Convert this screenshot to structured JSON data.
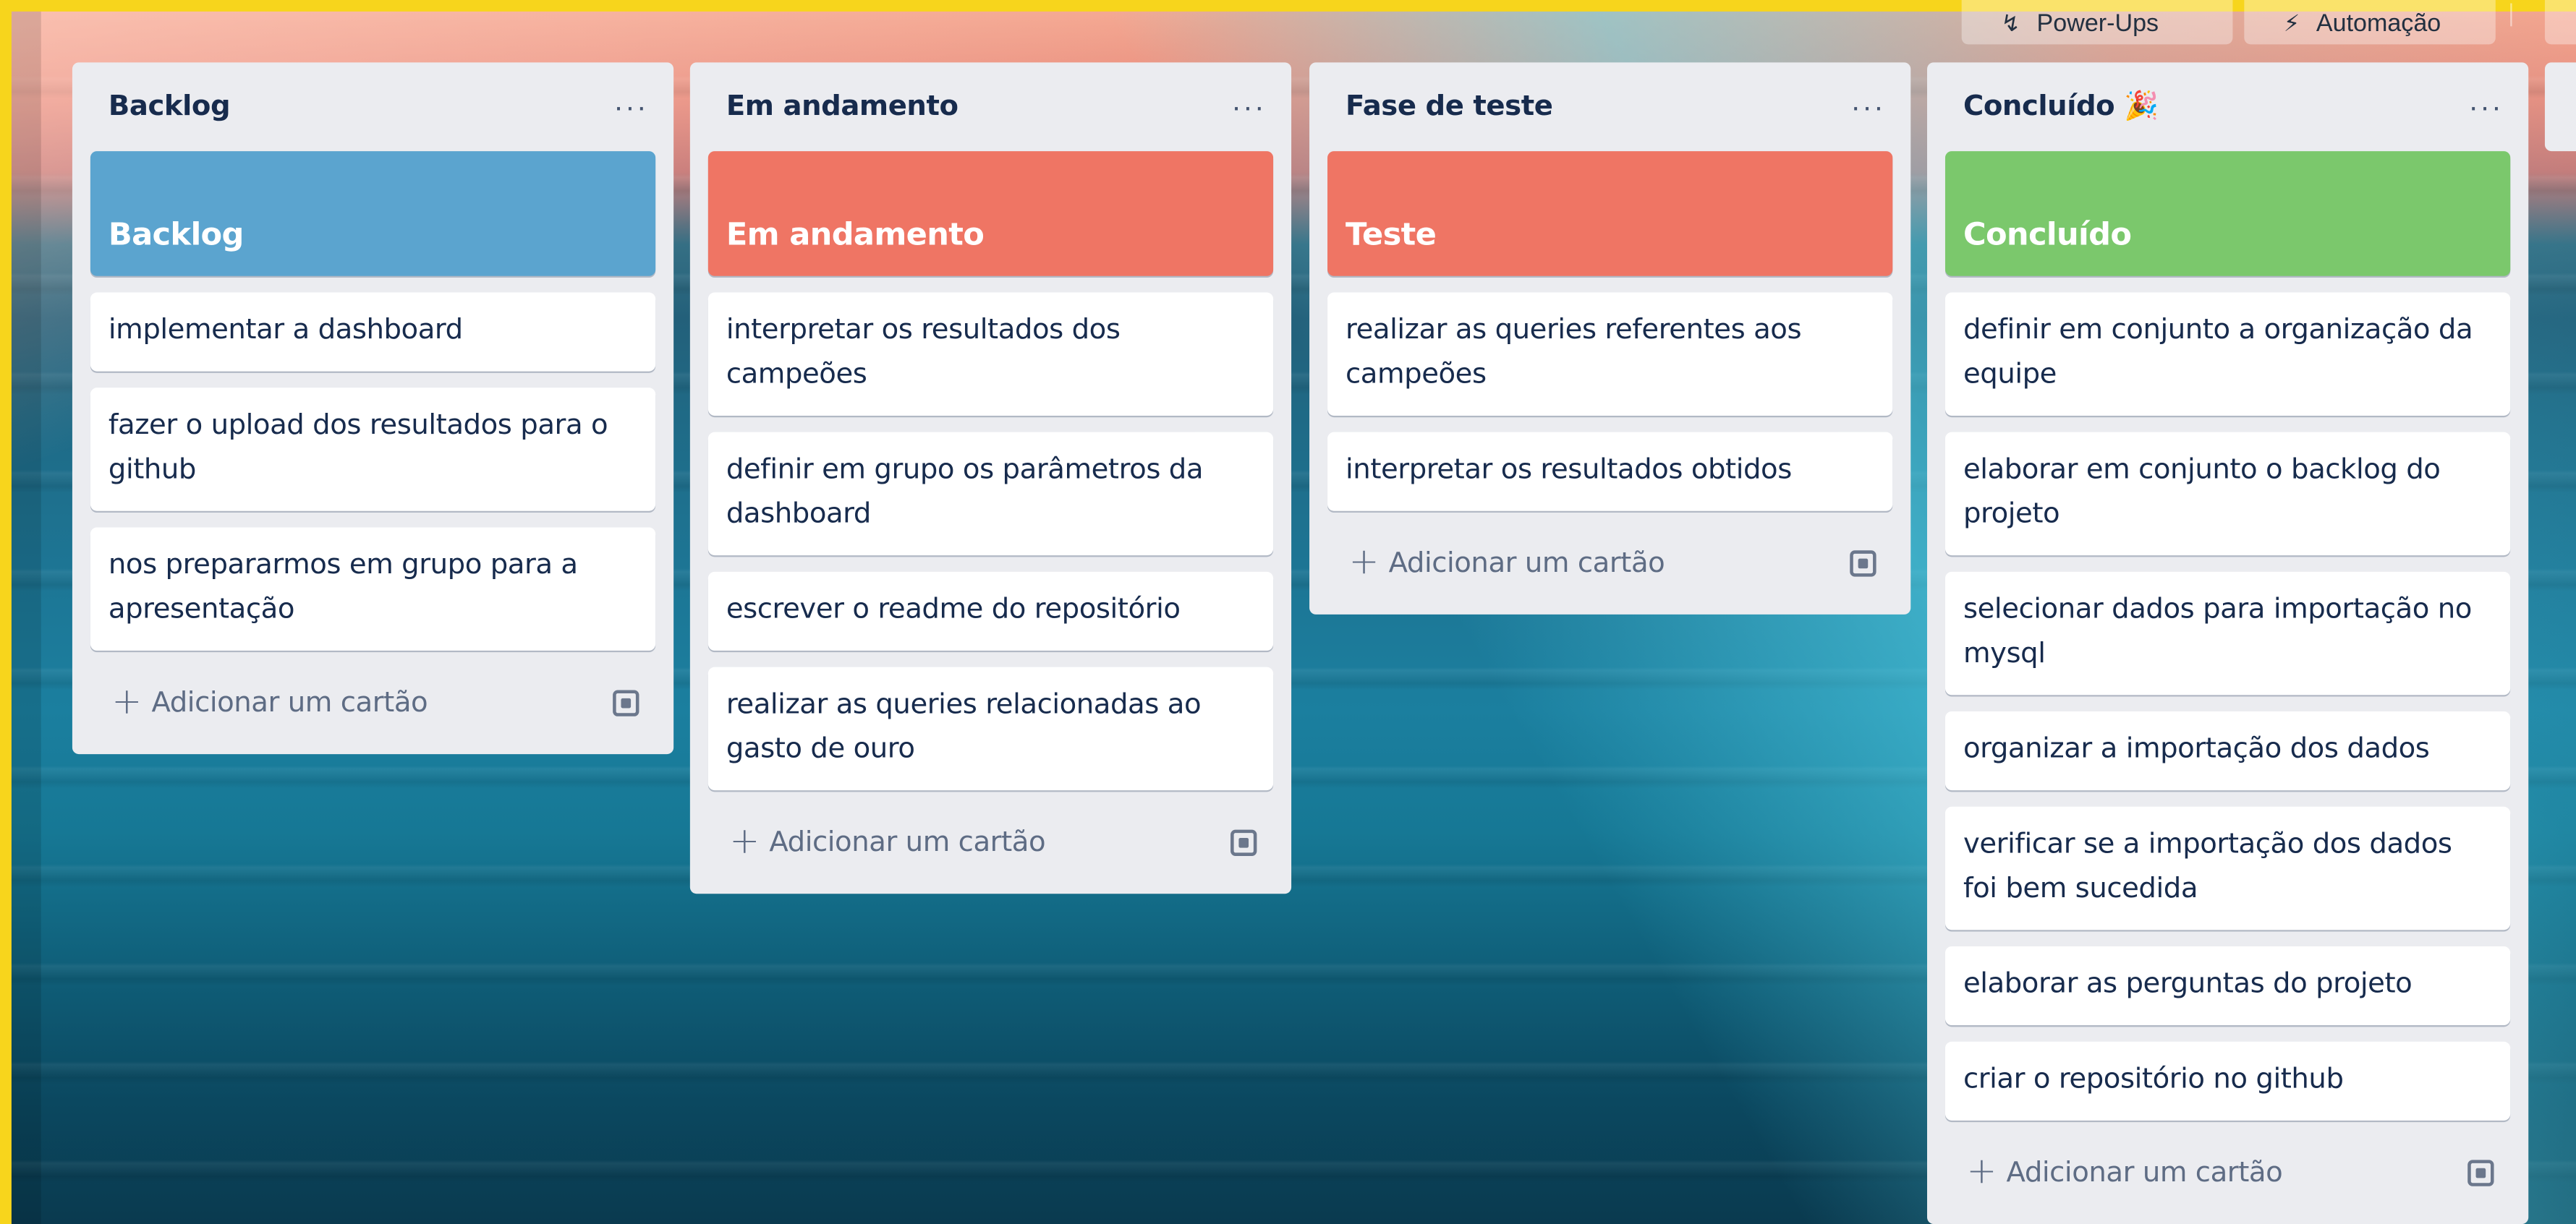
{
  "topbar": {
    "powerups_label": "Power-Ups",
    "automation_label": "Automação"
  },
  "lists": [
    {
      "title": "Backlog",
      "menu": "···",
      "cover": {
        "label": "Backlog",
        "color": "#5ba4cf"
      },
      "cards": [
        "implementar a dashboard",
        "fazer o upload dos resultados para o github",
        "nos prepararmos em grupo para a apresentação"
      ],
      "add_label": "Adicionar um cartão"
    },
    {
      "title": "Em andamento",
      "menu": "···",
      "cover": {
        "label": "Em andamento",
        "color": "#ef7564"
      },
      "cards": [
        "interpretar os resultados dos campeões",
        "definir em grupo os parâmetros da dashboard",
        "escrever o readme do repositório",
        "realizar as queries relacionadas ao gasto de ouro"
      ],
      "add_label": "Adicionar um cartão"
    },
    {
      "title": "Fase de teste",
      "menu": "···",
      "cover": {
        "label": "Teste",
        "color": "#ef7564"
      },
      "cards": [
        "realizar as queries referentes aos campeões",
        "interpretar os resultados obtidos"
      ],
      "add_label": "Adicionar um cartão"
    },
    {
      "title": "Concluído 🎉",
      "menu": "···",
      "cover": {
        "label": "Concluído",
        "color": "#7bc86c"
      },
      "cards": [
        "definir em conjunto a organização da equipe",
        "elaborar em conjunto o backlog do projeto",
        "selecionar dados para importação no mysql",
        "organizar a importação dos dados",
        "verificar se a importação dos dados foi bem sucedida",
        "elaborar as perguntas do projeto",
        "criar o repositório no github"
      ],
      "add_label": "Adicionar um cartão"
    }
  ]
}
